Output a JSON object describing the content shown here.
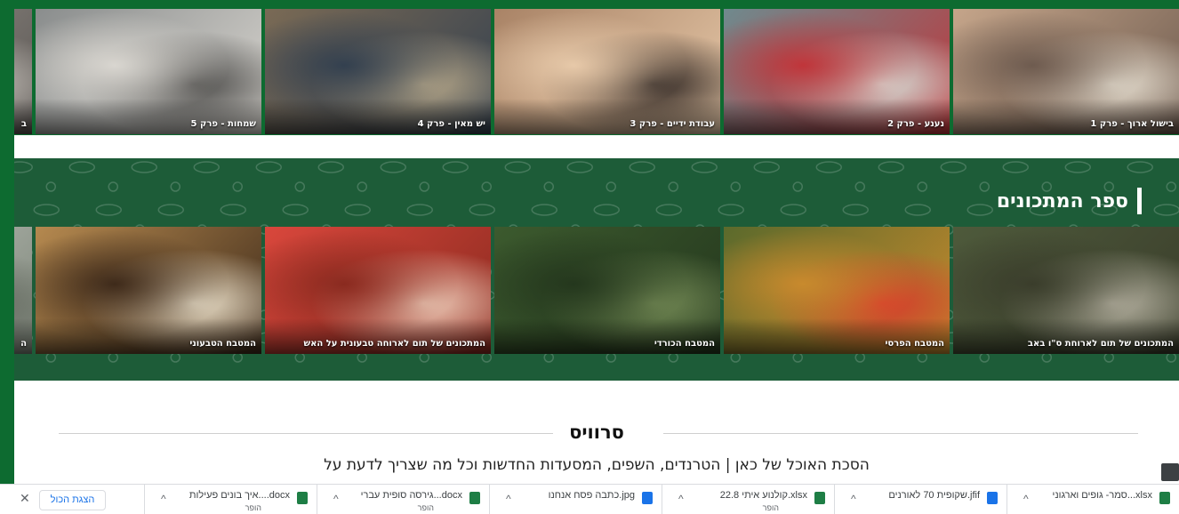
{
  "episodes": [
    {
      "caption": "בישול ארוך - פרק 1",
      "palette": [
        "#c5a58a",
        "#6e5b4f",
        "#e7e0d2"
      ]
    },
    {
      "caption": "נענע - פרק 2",
      "palette": [
        "#6f8a8e",
        "#c0353a",
        "#d8ddd6"
      ]
    },
    {
      "caption": "עבודת ידיים - פרק 3",
      "palette": [
        "#a98366",
        "#e7c9a9",
        "#2b2320"
      ]
    },
    {
      "caption": "יש מאין - פרק 4",
      "palette": [
        "#7a6a55",
        "#33404f",
        "#b7a88a"
      ]
    },
    {
      "caption": "שמחות - פרק 5",
      "palette": [
        "#8a8d8d",
        "#d9d6d0",
        "#4b4a48"
      ]
    },
    {
      "caption": "ב",
      "palette": [
        "#9e9a93",
        "#5a5552",
        "#cfcac3"
      ]
    }
  ],
  "recipes": {
    "title": "ספר המתכונים",
    "items": [
      {
        "caption": "המתכונים של תום לארוחת ס\"ו באב",
        "palette": [
          "#4e5a3b",
          "#3a3d2b",
          "#b9b4a4"
        ]
      },
      {
        "caption": "המטבח הפרסי",
        "palette": [
          "#5b6a2c",
          "#c88a2d",
          "#d93b2c"
        ]
      },
      {
        "caption": "המטבח הכורדי",
        "palette": [
          "#3c5a2e",
          "#24371d",
          "#758b56"
        ]
      },
      {
        "caption": "המתכונים של תום לארוחה טבעונית על האש",
        "palette": [
          "#d9473c",
          "#8a2a1f",
          "#efd1bd"
        ]
      },
      {
        "caption": "המטבח הטבעוני",
        "palette": [
          "#b5894f",
          "#3e2a1a",
          "#efe5cf"
        ]
      },
      {
        "caption": "ה",
        "palette": [
          "#c9cfc6",
          "#7e857a",
          "#5b6157"
        ]
      }
    ]
  },
  "service": {
    "title": "סרוויס",
    "subtitle": "הסכת האוכל של כאן | הטרנדים, השפים, המסעדות החדשות וכל מה שצריך לדעת על"
  },
  "downloads": {
    "items": [
      {
        "name": "xlsx...סמר- גופים וארגוני",
        "status": "",
        "icon": "excel-icon",
        "color": "#1e7e45"
      },
      {
        "name": "jfif.שקופית 70 לאורנים",
        "status": "",
        "icon": "image-file-icon",
        "color": "#1a73e8"
      },
      {
        "name": "xlsx.קולנוע איתי 22.8",
        "status": "הופר",
        "icon": "excel-icon",
        "color": "#1e7e45"
      },
      {
        "name": "jpg.כתבה פסח אנחנו",
        "status": "",
        "icon": "image-file-icon",
        "color": "#1a73e8"
      },
      {
        "name": "docx...גירסה סופית עברי",
        "status": "הופר",
        "icon": "word-icon",
        "color": "#1e7e45"
      },
      {
        "name": "docx....איך בונים פעילות",
        "status": "הופר",
        "icon": "word-icon",
        "color": "#1e7e45"
      }
    ],
    "show_all": "הצגת הכול",
    "close_symbol": "✕"
  }
}
